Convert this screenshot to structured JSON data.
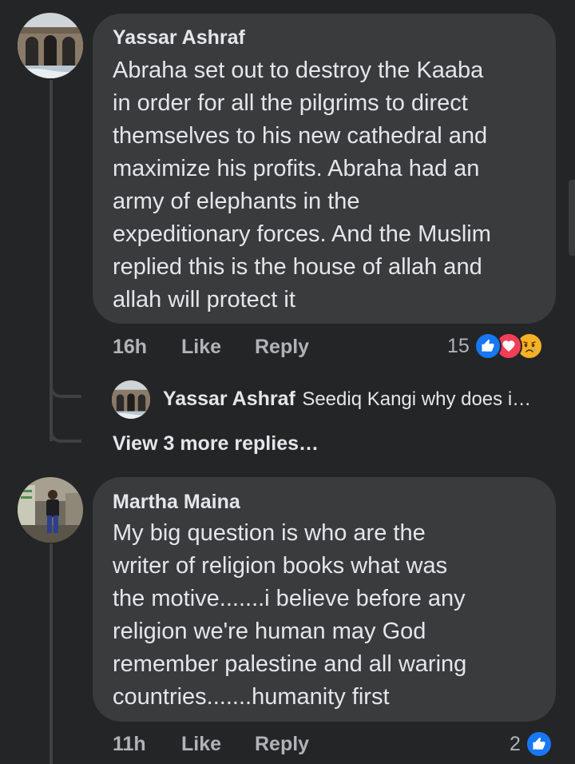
{
  "comments": [
    {
      "author": "Yassar Ashraf",
      "text": "Abraha set out to destroy the Kaaba\nin order for all the pilgrims to direct\nthemselves to his new cathedral and\nmaximize his profits. Abraha had an\narmy of elephants in the\nexpeditionary forces. And the Muslim\nreplied this is the house of allah and\nallah will protect it",
      "time": "16h",
      "like_label": "Like",
      "reply_label": "Reply",
      "reaction_count": "15",
      "reactions": [
        "like-icon",
        "love-icon",
        "sad-icon"
      ],
      "reply_preview": {
        "author": "Yassar Ashraf",
        "snippet": "Seediq Kangi why does i…"
      },
      "view_more": "View 3 more replies…"
    },
    {
      "author": "Martha Maina",
      "text": "My big question is who are the\nwriter of religion books what was\nthe motive.......i believe before any\nreligion we're human may God\nremember palestine and all waring\ncountries.......humanity first",
      "time": "11h",
      "like_label": "Like",
      "reply_label": "Reply",
      "reaction_count": "2",
      "reactions": [
        "like-icon"
      ]
    }
  ],
  "colors": {
    "background": "#242526",
    "bubble": "#3a3b3c",
    "like_blue": "#1877f2",
    "love_red": "#f33e58",
    "sad_yellow": "#f7b125"
  }
}
